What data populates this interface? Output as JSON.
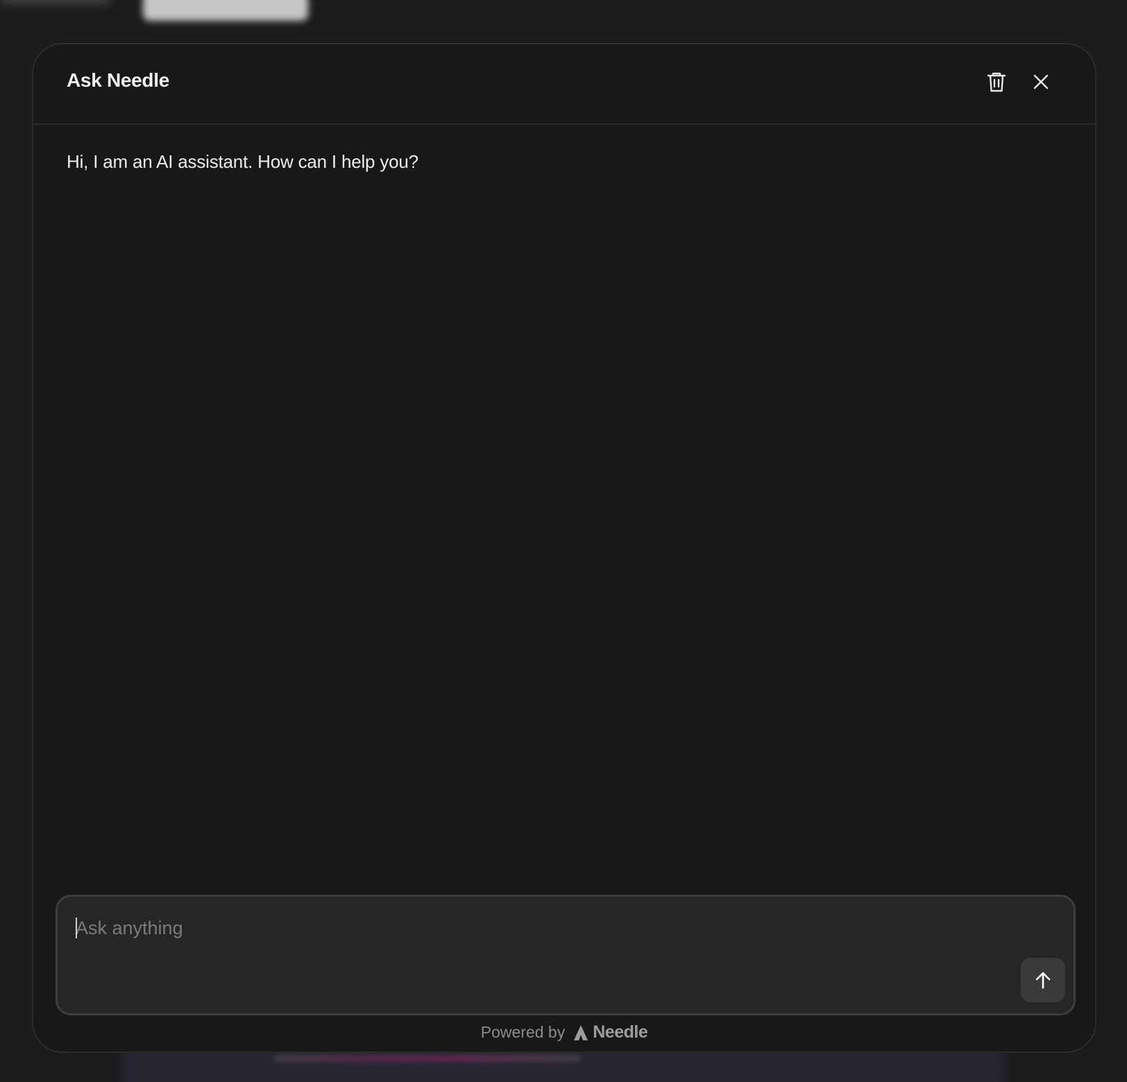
{
  "dialog": {
    "title": "Ask Needle",
    "icons": {
      "delete": "trash-icon",
      "close": "close-icon"
    }
  },
  "chat": {
    "messages": [
      {
        "role": "assistant",
        "text": "Hi, I am an AI assistant. How can I help you?"
      }
    ]
  },
  "composer": {
    "placeholder": "Ask anything",
    "value": "",
    "send_icon": "arrow-up-icon"
  },
  "footer": {
    "powered_by": "Powered by",
    "brand_name": "Needle",
    "brand_icon": "needle-logo-icon"
  },
  "colors": {
    "modal_bg": "#181819",
    "page_bg": "#1c1c1d",
    "text_primary": "#f2f2f2",
    "muted": "#8a8a8b"
  }
}
